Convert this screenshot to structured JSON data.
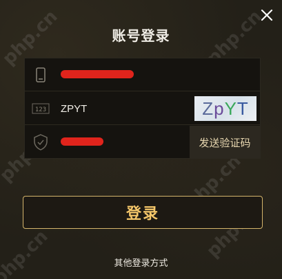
{
  "dialog": {
    "title": "账号登录"
  },
  "form": {
    "phone_field": {
      "icon": "phone-icon",
      "value_hidden": true
    },
    "captcha_field": {
      "icon": "captcha-123-icon",
      "value": "ZPYT"
    },
    "captcha_image": {
      "chars": [
        "Z",
        "p",
        "Y",
        "T"
      ],
      "colors": [
        "#5a6a9a",
        "#6a4a9a",
        "#3aa85a",
        "#3a5aa0"
      ]
    },
    "sms_field": {
      "icon": "shield-icon",
      "value_hidden": true
    },
    "send_code_label": "发送验证码"
  },
  "login_button": {
    "label": "登录"
  },
  "other_login": {
    "label": "其他登录方式"
  },
  "colors": {
    "accent": "#d6b66c",
    "login_text": "#f5c76a",
    "redaction": "#e0241c"
  }
}
